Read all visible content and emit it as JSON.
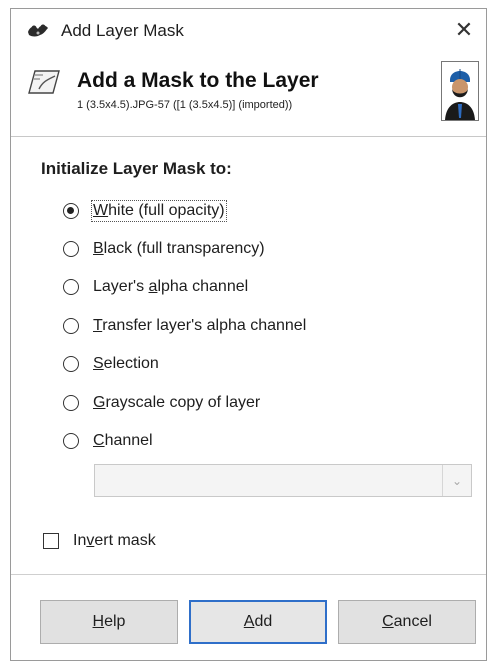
{
  "window": {
    "title": "Add Layer Mask",
    "close_glyph": "✕"
  },
  "header": {
    "title": "Add a Mask to the Layer",
    "subtitle": "1 (3.5x4.5).JPG-57 ([1 (3.5x4.5)] (imported))",
    "icon": "layer-mask-icon",
    "thumbnail": "layer-thumbnail"
  },
  "init": {
    "label": "Initialize Layer Mask to:",
    "options": [
      {
        "pre": "",
        "mn": "W",
        "post": "hite (full opacity)",
        "checked": true
      },
      {
        "pre": "",
        "mn": "B",
        "post": "lack (full transparency)",
        "checked": false
      },
      {
        "pre": "Layer's ",
        "mn": "a",
        "post": "lpha channel",
        "checked": false
      },
      {
        "pre": "",
        "mn": "T",
        "post": "ransfer layer's alpha channel",
        "checked": false
      },
      {
        "pre": "",
        "mn": "S",
        "post": "election",
        "checked": false
      },
      {
        "pre": "",
        "mn": "G",
        "post": "rayscale copy of layer",
        "checked": false
      },
      {
        "pre": "",
        "mn": "C",
        "post": "hannel",
        "checked": false
      }
    ],
    "channel_select": {
      "value": "",
      "disabled": true
    }
  },
  "invert": {
    "pre": "In",
    "mn": "v",
    "post": "ert mask",
    "checked": false
  },
  "buttons": {
    "help": {
      "pre": "",
      "mn": "H",
      "post": "elp"
    },
    "add": {
      "pre": "",
      "mn": "A",
      "post": "dd"
    },
    "cancel": {
      "pre": "",
      "mn": "C",
      "post": "ancel"
    }
  },
  "colors": {
    "default_button_border": "#2f6fc9",
    "button_face": "#e1e1e1",
    "thumbnail_turban": "#1e5fa8"
  }
}
